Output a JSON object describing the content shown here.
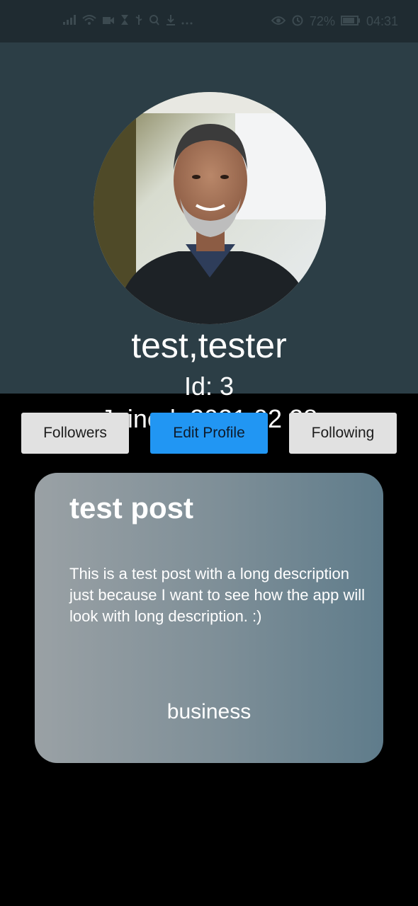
{
  "status_bar": {
    "battery_percent": "72%",
    "time": "04:31",
    "left_icons": [
      "signal-icon",
      "wifi-icon",
      "video-icon",
      "hourglass-icon",
      "usb-icon",
      "search-q-icon",
      "download-icon",
      "more-icon"
    ],
    "right_icons": [
      "eye-icon",
      "alarm-icon",
      "battery-icon"
    ]
  },
  "profile": {
    "name": "test,tester",
    "id_text": "Id: 3",
    "joined_text": "Joined: 2021 02 28"
  },
  "buttons": {
    "followers": "Followers",
    "edit_profile": "Edit Profile",
    "following": "Following"
  },
  "post": {
    "title": "test post",
    "description": "This is a test post with a long description just because I want to see how the app will look with long description. :)",
    "category": "business"
  },
  "colors": {
    "header_bg": "#2c3e46",
    "status_bar_bg": "#1f2b31",
    "page_bg": "#000000",
    "accent": "#2196f3",
    "button_bg": "#e1e1e1"
  }
}
